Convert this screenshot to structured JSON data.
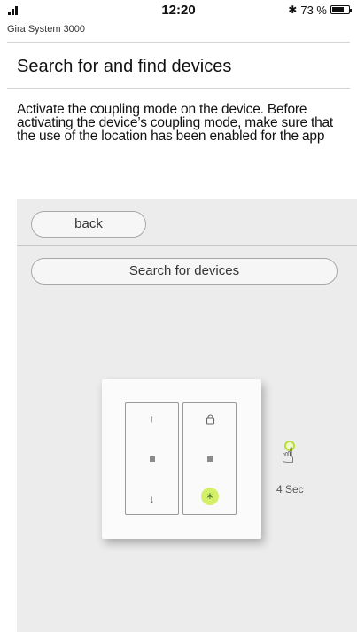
{
  "status_bar": {
    "signal_bars": 3,
    "time": "12:20",
    "bluetooth_icon": "bluetooth-icon",
    "battery_percent": "73 %",
    "battery_level": 0.73
  },
  "app": {
    "name": "Gira System 3000"
  },
  "page": {
    "title": "Search for and find devices",
    "instructions": "Activate the coupling mode on the device. Before activating the device’s coupling mode, make sure that the use of the location has been enabled for the app"
  },
  "panel": {
    "back_label": "back",
    "search_label": "Search for devices"
  },
  "device": {
    "left_rocker": {
      "top_icon": "arrow-up-icon",
      "top_symbol": "↑",
      "bottom_icon": "arrow-down-icon",
      "bottom_symbol": "↓"
    },
    "right_rocker": {
      "top_icon": "lock-icon",
      "bottom_icon": "bluetooth-icon",
      "bottom_symbol": "∗",
      "highlight_color": "#d4f06a"
    },
    "hold_icon": "hand-pointer-icon",
    "hold_duration": "4 Sec"
  }
}
